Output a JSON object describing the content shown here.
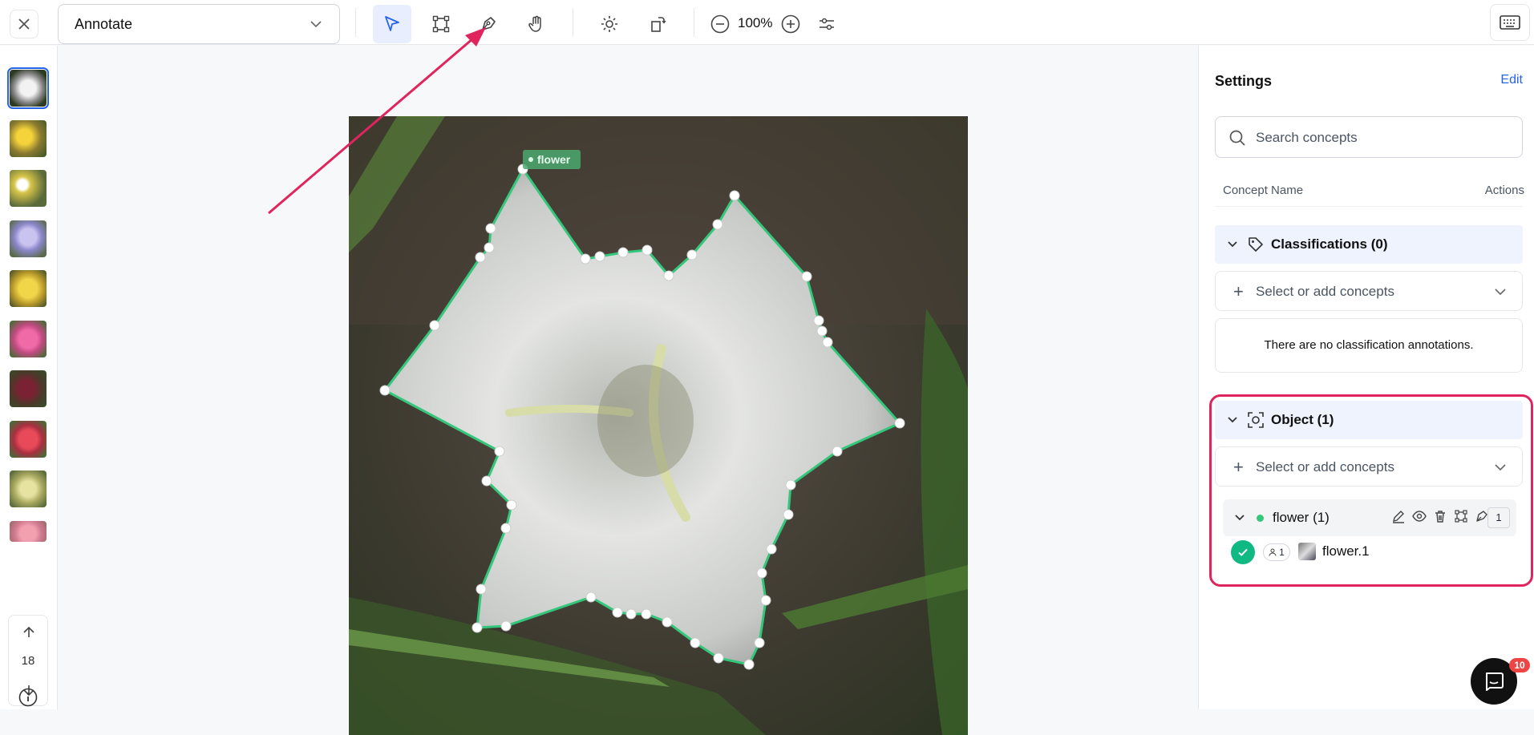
{
  "toolbar": {
    "mode": "Annotate",
    "zoom": "100%",
    "active_tool": "select"
  },
  "sidebar": {
    "page_count": "18",
    "thumbnails": [
      "white-flower",
      "yellow-flowers",
      "daisies",
      "purple-flower",
      "yellow-flower",
      "pink-flower",
      "dark-red-flowers",
      "red-flower",
      "pale-yellow-flower",
      "pink-flowers"
    ]
  },
  "canvas": {
    "annotation_label": "flower",
    "polygon_color": "#34c77b"
  },
  "settings": {
    "title": "Settings",
    "edit": "Edit",
    "search_placeholder": "Search concepts",
    "col_concept": "Concept Name",
    "col_actions": "Actions",
    "classifications_label": "Classifications (0)",
    "select_placeholder": "Select or add concepts",
    "no_classifications": "There are no classification annotations.",
    "object_label": "Object (1)",
    "object_select_placeholder": "Select or add concepts",
    "concept_row": {
      "label": "flower (1)",
      "count": "1"
    },
    "object_item": {
      "annotator_count": "1",
      "name": "flower.1"
    }
  },
  "chat": {
    "badge": "10"
  },
  "colors": {
    "accent": "#2563eb",
    "highlight": "#e0245e",
    "success": "#10b981"
  }
}
